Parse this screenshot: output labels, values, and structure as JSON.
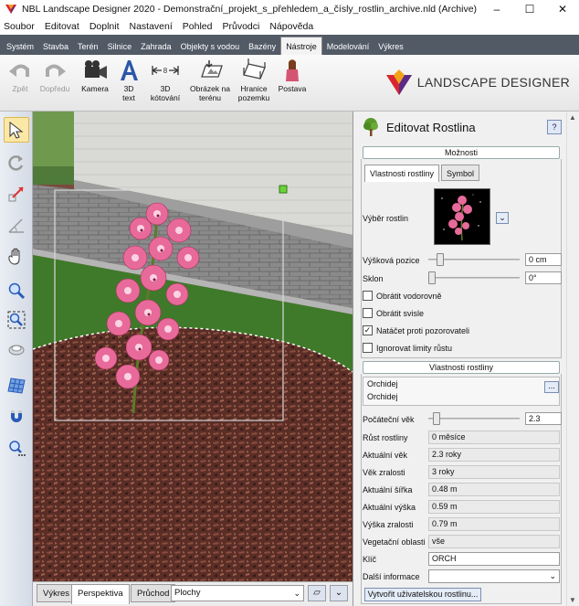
{
  "window": {
    "title": "NBL Landscape Designer 2020 - Demonstrační_projekt_s_přehledem_a_čísly_rostlin_archive.nld (Archive)",
    "minimize": "–",
    "maximize": "☐",
    "close": "✕"
  },
  "menu": [
    "Soubor",
    "Editovat",
    "Doplnit",
    "Nastavení",
    "Pohled",
    "Průvodci",
    "Nápověda"
  ],
  "ribbon_tabs": [
    {
      "label": "Systém"
    },
    {
      "label": "Stavba"
    },
    {
      "label": "Terén"
    },
    {
      "label": "Silnice"
    },
    {
      "label": "Zahrada"
    },
    {
      "label": "Objekty s vodou"
    },
    {
      "label": "Bazény"
    },
    {
      "label": "Nástroje",
      "active": true
    },
    {
      "label": "Modelování"
    },
    {
      "label": "Výkres"
    }
  ],
  "toolbar": {
    "back": "Zpět",
    "forward": "Dopředu",
    "camera": "Kamera",
    "text3d": [
      "3D",
      "text"
    ],
    "dim3d": [
      "3D",
      "kótování"
    ],
    "terrain_image": [
      "Obrázek na",
      "terénu"
    ],
    "parcel_border": [
      "Hranice",
      "pozemku"
    ],
    "figure": "Postava",
    "dim_icon_text": "8"
  },
  "logo": {
    "text": "LANDSCAPE DESIGNER"
  },
  "left_tools": [
    {
      "name": "select",
      "icon": "arrow-cursor-icon",
      "selected": true
    },
    {
      "name": "rotate",
      "icon": "rotate-icon"
    },
    {
      "name": "scale",
      "icon": "resize-icon"
    },
    {
      "name": "measure-angle",
      "icon": "angle-icon"
    },
    {
      "name": "pan",
      "icon": "hand-icon"
    },
    {
      "name": "zoom",
      "icon": "zoom-icon"
    },
    {
      "name": "zoom-extents",
      "icon": "zoom-extents-icon"
    },
    {
      "name": "orbit",
      "icon": "orbit-icon"
    },
    {
      "name": "grid",
      "icon": "grid-icon"
    },
    {
      "name": "magnet",
      "icon": "magnet-icon"
    },
    {
      "name": "zoom-more",
      "icon": "zoom-more-icon"
    }
  ],
  "bottom": {
    "tabs": [
      {
        "label": "Výkres"
      },
      {
        "label": "Perspektiva",
        "active": true
      },
      {
        "label": "Průchod"
      }
    ],
    "layer": "Plochy"
  },
  "panel": {
    "title": "Editovat Rostlina",
    "help": "?",
    "options_header": "Možnosti",
    "inner_tabs": [
      {
        "label": "Vlastnosti rostliny",
        "active": true
      },
      {
        "label": "Symbol"
      }
    ],
    "plant_select_label": "Výběr rostlin",
    "height_label": "Výšková pozice",
    "height_value": "0 cm",
    "height_slider": 0.1,
    "tilt_label": "Sklon",
    "tilt_value": "0°",
    "tilt_slider": 0.0,
    "checkboxes": [
      {
        "label": "Obrátit vodorovně",
        "checked": false
      },
      {
        "label": "Obrátit svisle",
        "checked": false
      },
      {
        "label": "Natáčet proti pozorovateli",
        "checked": true
      },
      {
        "label": "Ignorovat limity růstu",
        "checked": false
      }
    ],
    "props_header": "Vlastnosti rostliny",
    "species": [
      "Orchidej",
      "Orchidej"
    ],
    "species_button": "...",
    "start_age_label": "Počáteční věk",
    "start_age_value": "2.3",
    "start_age_slider": 0.05,
    "fields": [
      {
        "label": "Růst rostliny",
        "value": "0 měsíce"
      },
      {
        "label": "Aktuální věk",
        "value": "2.3 roky"
      },
      {
        "label": "Věk zralosti",
        "value": "3 roky"
      },
      {
        "label": "Aktuální šířka",
        "value": "0.48 m"
      },
      {
        "label": "Aktuální výška",
        "value": "0.59 m"
      },
      {
        "label": "Výška zralosti",
        "value": "0.79 m"
      },
      {
        "label": "Vegetační oblasti",
        "value": "vše"
      }
    ],
    "key_label": "Klíč",
    "key_value": "ORCH",
    "more_label": "Další informace",
    "more_value": "",
    "create_button": "Vytvořit uživatelskou rostlinu..."
  }
}
